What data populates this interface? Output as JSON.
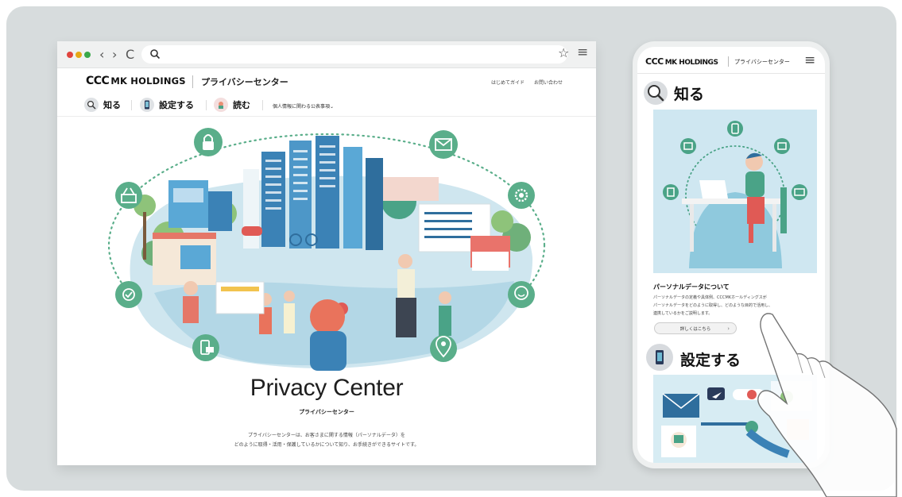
{
  "browser": {
    "back_icon": "‹",
    "forward_icon": "›",
    "reload_icon": "C",
    "star_icon": "☆",
    "menu_icon": "≡"
  },
  "site": {
    "logo_ccc": "CCC",
    "logo_mk": "MK HOLDINGS",
    "subtitle": "プライバシーセンター",
    "header_links": [
      "はじめてガイド",
      "お問い合わせ"
    ],
    "nav": [
      {
        "label": "知る",
        "icon": "magnifier-icon"
      },
      {
        "label": "設定する",
        "icon": "smartphone-icon"
      },
      {
        "label": "読む",
        "icon": "book-icon"
      }
    ],
    "related_link": "個人情報に関わる公表事項⌄"
  },
  "hero": {
    "title": "Privacy Center",
    "subtitle": "プライバシーセンター",
    "desc_line1": "プライバシーセンターは、お客さまに関する情報（パーソナルデータ）を",
    "desc_line2": "どのように取得・活用・保護しているかについて知り、お手続きができるサイトです。",
    "orbit_icons": [
      "lock-icon",
      "mail-icon",
      "basket-icon",
      "gear-icon",
      "touch-check-icon",
      "face-icon",
      "phone-card-icon",
      "location-pin-icon"
    ]
  },
  "phone": {
    "logo_ccc": "CCC",
    "logo_mk": "MK HOLDINGS",
    "subtitle": "プライバシーセンター",
    "menu_icon": "≡",
    "know_title": "知る",
    "card_title": "パーソナルデータについて",
    "card_lines": [
      "パーソナルデータの定義や具体例、CCCMKホールディングスが",
      "パーソナルデータをどのように取得し、どのような目的で活用し、",
      "連携しているかをご説明します。"
    ],
    "more_label": "詳しくはこちら",
    "more_chevron": "›",
    "set_title": "設定する"
  },
  "colors": {
    "panel": "#d7dcdd",
    "dot_red": "#e0443e",
    "dot_yellow": "#e6a817",
    "dot_green": "#3aa84a",
    "orbit_green": "#5aae8a",
    "accent_teal": "#53aa90"
  }
}
